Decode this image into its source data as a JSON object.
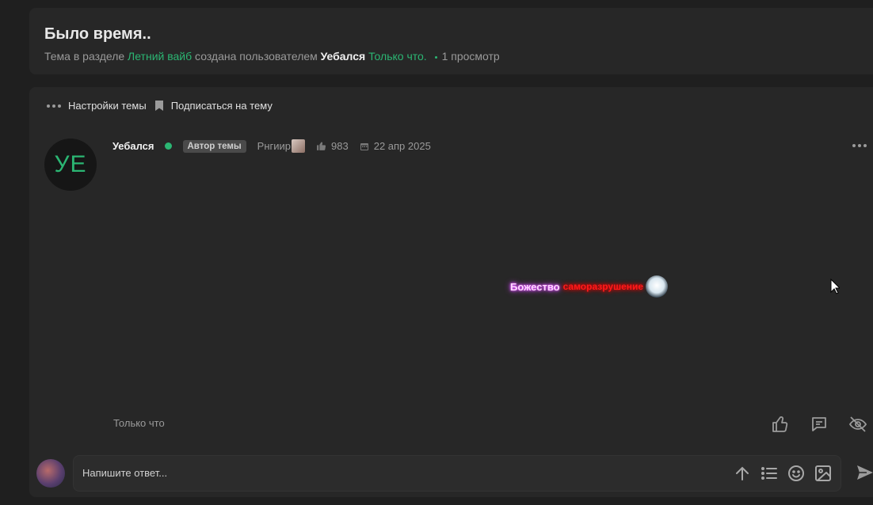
{
  "thread": {
    "title": "Было время..",
    "meta_prefix": "Тема в разделе",
    "section": "Летний вайб",
    "created_by": "создана пользователем",
    "author": "Уебался",
    "created_time": "Только что.",
    "views": "1 просмотр"
  },
  "topic_actions": {
    "settings_label": "Настройки темы",
    "subscribe_label": "Подписаться на тему"
  },
  "post": {
    "avatar_initials": "УЕ",
    "author": "Уебался",
    "badge": "Автор темы",
    "rank": "Рнгиир",
    "likes": "983",
    "date": "22 апр 2025",
    "body_word1": "Божество",
    "body_word2": "саморазрушение",
    "time": "Только что"
  },
  "reply": {
    "placeholder": "Напишите ответ..."
  },
  "colors": {
    "accent_green": "#2bb673",
    "background": "#1f1f1f",
    "panel": "#272727"
  }
}
